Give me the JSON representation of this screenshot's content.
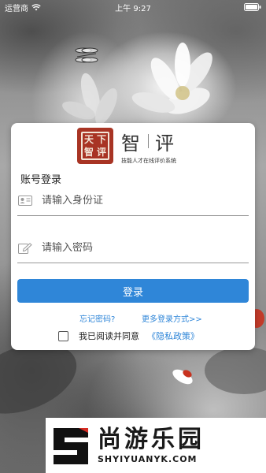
{
  "status_bar": {
    "carrier": "运营商",
    "time": "上午 9:27"
  },
  "brand": {
    "seal_chars": [
      "天",
      "下",
      "智",
      "评"
    ],
    "title_left": "智",
    "title_right": "评",
    "subtitle": "技能人才在线评价系统"
  },
  "login": {
    "section_title": "账号登录",
    "id_field": {
      "placeholder": "请输入身份证",
      "value": ""
    },
    "password_field": {
      "placeholder": "请输入密码",
      "value": ""
    },
    "login_button": "登录",
    "forgot_link": "忘记密码?",
    "more_link": "更多登录方式>>",
    "agree_text": "我已阅读并同意",
    "policy_link": "《隐私政策》",
    "agree_checked": false
  },
  "watermark": {
    "name": "尚游乐园",
    "url": "SHYIYUANYK.COM"
  },
  "colors": {
    "accent": "#2f86d8",
    "seal": "#a83424"
  }
}
